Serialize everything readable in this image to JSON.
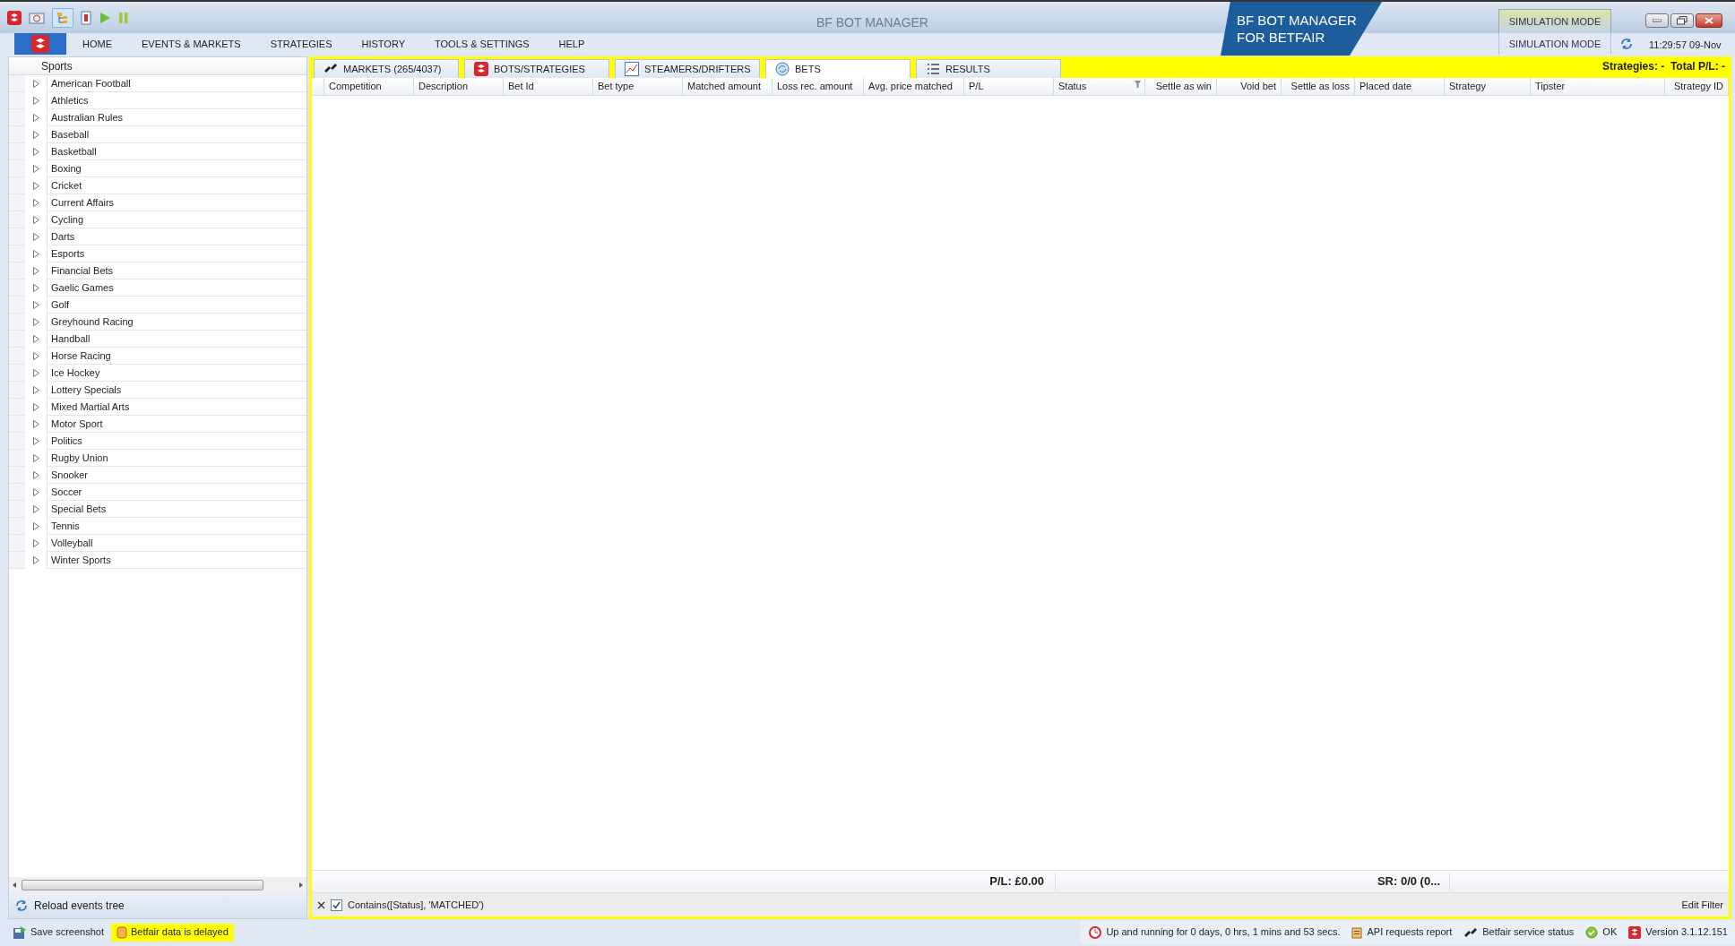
{
  "window": {
    "title": "BF BOT MANAGER"
  },
  "menu": [
    {
      "label": "HOME"
    },
    {
      "label": "EVENTS & MARKETS"
    },
    {
      "label": "STRATEGIES"
    },
    {
      "label": "HISTORY"
    },
    {
      "label": "TOOLS & SETTINGS"
    },
    {
      "label": "HELP"
    }
  ],
  "banner": {
    "line_1": "BF BOT MANAGER",
    "line_2": "FOR BETFAIR"
  },
  "mode": {
    "upper": "SIMULATION MODE",
    "lower": "SIMULATION MODE"
  },
  "clock": "11:29:57 09-Nov",
  "sidebar": {
    "header": "Sports",
    "items": [
      {
        "label": "American Football",
        "expanded": false
      },
      {
        "label": "Athletics",
        "expanded": false
      },
      {
        "label": "Australian Rules",
        "expanded": false
      },
      {
        "label": "Baseball",
        "expanded": false
      },
      {
        "label": "Basketball",
        "expanded": false
      },
      {
        "label": "Boxing",
        "expanded": false
      },
      {
        "label": "Cricket",
        "expanded": false
      },
      {
        "label": "Current Affairs",
        "expanded": false
      },
      {
        "label": "Cycling",
        "expanded": false
      },
      {
        "label": "Darts",
        "expanded": false
      },
      {
        "label": "Esports",
        "expanded": false
      },
      {
        "label": "Financial Bets",
        "expanded": false
      },
      {
        "label": "Gaelic Games",
        "expanded": false
      },
      {
        "label": "Golf",
        "expanded": false
      },
      {
        "label": "Greyhound Racing",
        "expanded": false
      },
      {
        "label": "Handball",
        "expanded": false
      },
      {
        "label": "Horse Racing",
        "expanded": false
      },
      {
        "label": "Ice Hockey",
        "expanded": false
      },
      {
        "label": "Lottery Specials",
        "expanded": false
      },
      {
        "label": "Mixed Martial Arts",
        "expanded": false
      },
      {
        "label": "Motor Sport",
        "expanded": false
      },
      {
        "label": "Politics",
        "expanded": false
      },
      {
        "label": "Rugby Union",
        "expanded": false
      },
      {
        "label": "Snooker",
        "expanded": false
      },
      {
        "label": "Soccer",
        "expanded": false
      },
      {
        "label": "Special Bets",
        "expanded": false
      },
      {
        "label": "Tennis",
        "expanded": false
      },
      {
        "label": "Volleyball",
        "expanded": false
      },
      {
        "label": "Winter Sports",
        "expanded": false
      }
    ],
    "reload": "Reload events tree"
  },
  "tabs": [
    {
      "label": "MARKETS (265/4037)",
      "kind": "markets",
      "selected": false
    },
    {
      "label": "BOTS/STRATEGIES",
      "kind": "bots",
      "selected": false
    },
    {
      "label": "STEAMERS/DRIFTERS",
      "kind": "chart",
      "selected": false
    },
    {
      "label": "BETS",
      "kind": "bets",
      "selected": true
    },
    {
      "label": "RESULTS",
      "kind": "list",
      "selected": false
    }
  ],
  "strategies_summary": "Strategies: -  Total P/L: -",
  "table": {
    "columns": [
      {
        "label": "Competition",
        "filtered": false
      },
      {
        "label": "Description",
        "filtered": false
      },
      {
        "label": "Bet Id",
        "filtered": false
      },
      {
        "label": "Bet type",
        "filtered": false
      },
      {
        "label": "Matched amount",
        "filtered": false
      },
      {
        "label": "Loss rec. amount",
        "filtered": false
      },
      {
        "label": "Avg. price matched",
        "filtered": false
      },
      {
        "label": "P/L",
        "filtered": false
      },
      {
        "label": "Status",
        "filtered": true
      },
      {
        "label": "Settle as win",
        "filtered": false
      },
      {
        "label": "Void bet",
        "filtered": false
      },
      {
        "label": "Settle as loss",
        "filtered": false
      },
      {
        "label": "Placed date",
        "filtered": false
      },
      {
        "label": "Strategy",
        "filtered": false
      },
      {
        "label": "Tipster",
        "filtered": false
      },
      {
        "label": "Strategy ID",
        "filtered": false
      }
    ],
    "totals": {
      "pl": "P/L: £0.00",
      "sr": "SR: 0/0 (0..."
    }
  },
  "filter": {
    "checked": true,
    "text": "Contains([Status], 'MATCHED')",
    "edit": "Edit Filter"
  },
  "status_bar": {
    "save": "Save screenshot",
    "delayed": "Betfair data is delayed",
    "uptime": "Up and running for 0 days, 0 hrs, 1 mins and 53 secs.",
    "api": "API requests report",
    "service": "Betfair service status",
    "ok": "OK",
    "version": "Version 3.1.12.151"
  }
}
